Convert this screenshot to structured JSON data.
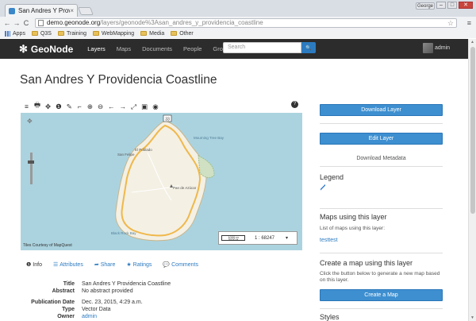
{
  "browser": {
    "tab_title": "San Andres Y Providencia",
    "tab_close": "×",
    "user_chip": "George",
    "win_min": "–",
    "win_max": "□",
    "win_close": "✕",
    "back": "←",
    "forward": "→",
    "reload": "C",
    "url_host": "demo.geonode.org",
    "url_path": "/layers/geonode%3Asan_andres_y_providencia_coastline",
    "star": "☆",
    "menu": "≡",
    "bookmarks": [
      "Apps",
      "Q3S",
      "Training",
      "WebMapping",
      "Media",
      "Other"
    ]
  },
  "header": {
    "logo_mark": "✻",
    "logo_text": "GeoNode",
    "nav": [
      "Layers",
      "Maps",
      "Documents",
      "People",
      "Groups"
    ],
    "search_placeholder": "Search",
    "search_icon": "🔍",
    "user": "admin"
  },
  "page": {
    "title": "San Andres Y Providencia Coastline"
  },
  "map": {
    "tool_icons": [
      "≡",
      "🖶",
      "✥",
      "❶",
      "✎",
      "⌐",
      "⊕",
      "⊖",
      "←",
      "→",
      "⤢",
      "▣",
      "◉"
    ],
    "help": "?",
    "credit": "Tiles Courtesy of MapQuest",
    "scale_bar_top": "1000 m",
    "scale_bar_bottom": "5000 ft",
    "scale_ratio": "1 : 68247",
    "scale_dd": "▾",
    "labels": {
      "road_number": "33",
      "bay_north": "Mourning Tree Bay",
      "town": "El Poblado",
      "peak": "Pan de Azúcar",
      "bay_south": "Black Rock Bay",
      "point_nw": "San Felipe"
    }
  },
  "info_tabs": [
    {
      "icon": "❶",
      "label": "Info"
    },
    {
      "icon": "☰",
      "label": "Attributes"
    },
    {
      "icon": "➦",
      "label": "Share"
    },
    {
      "icon": "★",
      "label": "Ratings"
    },
    {
      "icon": "💬",
      "label": "Comments"
    }
  ],
  "metadata": [
    {
      "key": "Title",
      "value": "San Andres Y Providencia Coastline"
    },
    {
      "key": "Abstract",
      "value": "No abstract provided"
    },
    {
      "key": "Publication Date",
      "value": "Dec. 23, 2015, 4:29 a.m."
    },
    {
      "key": "Type",
      "value": "Vector Data"
    },
    {
      "key": "Owner",
      "value": "admin"
    }
  ],
  "sidebar": {
    "download_layer": "Download Layer",
    "edit_layer": "Edit Layer",
    "download_metadata": "Download Metadata",
    "legend_heading": "Legend",
    "maps_heading": "Maps using this layer",
    "maps_desc": "List of maps using this layer:",
    "maps_link": "testtest",
    "create_heading": "Create a map using this layer",
    "create_desc": "Click the button below to generate a new map based on this layer.",
    "create_button": "Create a Map",
    "styles_heading": "Styles"
  },
  "colors": {
    "accent": "#3d8fd0",
    "header_bg": "#2c2c2c",
    "link": "#2c7bc0",
    "water": "#abd3df",
    "land": "#f4f0e4"
  }
}
